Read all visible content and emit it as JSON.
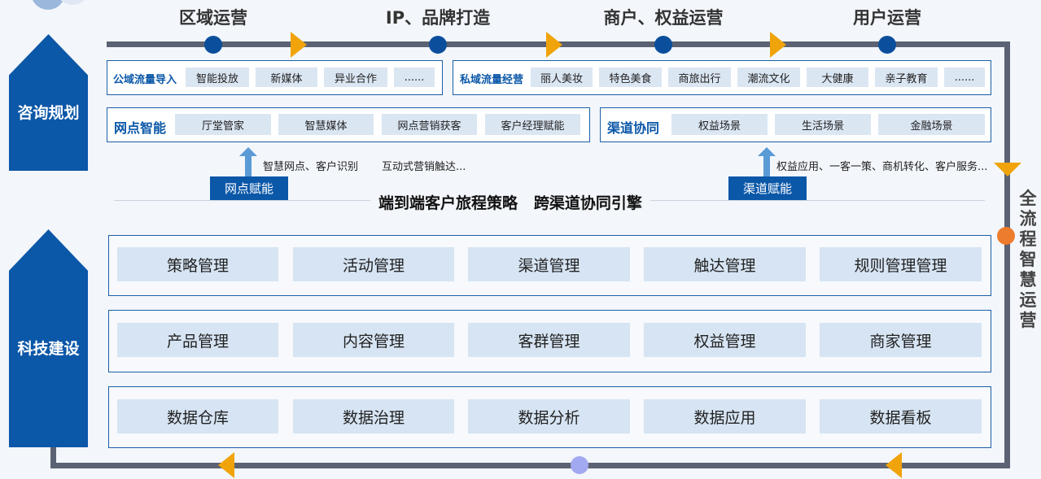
{
  "stages": [
    "区域运营",
    "IP、品牌打造",
    "商户、权益运营",
    "用户运营"
  ],
  "side_labels": {
    "top": "咨询规划",
    "bottom": "科技建设"
  },
  "right_label": "全流程智慧运营",
  "public_flow": {
    "title": "公域流量导入",
    "items": [
      "智能投放",
      "新媒体",
      "异业合作",
      "......"
    ]
  },
  "private_flow": {
    "title": "私域流量经营",
    "items": [
      "丽人美妆",
      "特色美食",
      "商旅出行",
      "潮流文化",
      "大健康",
      "亲子教育",
      "......"
    ]
  },
  "branch_smart": {
    "title": "网点智能",
    "items": [
      "厅堂管家",
      "智慧媒体",
      "网点营销获客",
      "客户经理赋能"
    ]
  },
  "channel_collab": {
    "title": "渠道协同",
    "items": [
      "权益场景",
      "生活场景",
      "金融场景"
    ]
  },
  "notes": {
    "left1": "智慧网点、客户识别",
    "left2": "互动式营销触达...",
    "right1": "权益应用、一客一策、商机转化、客户服务..."
  },
  "badges": {
    "left": "网点赋能",
    "right": "渠道赋能"
  },
  "center_title": "端到端客户旅程策略   跨渠道协同引擎",
  "modules": [
    [
      "策略管理",
      "活动管理",
      "渠道管理",
      "触达管理",
      "规则管理管理"
    ],
    [
      "产品管理",
      "内容管理",
      "客群管理",
      "权益管理",
      "商家管理"
    ],
    [
      "数据仓库",
      "数据治理",
      "数据分析",
      "数据应用",
      "数据看板"
    ]
  ]
}
